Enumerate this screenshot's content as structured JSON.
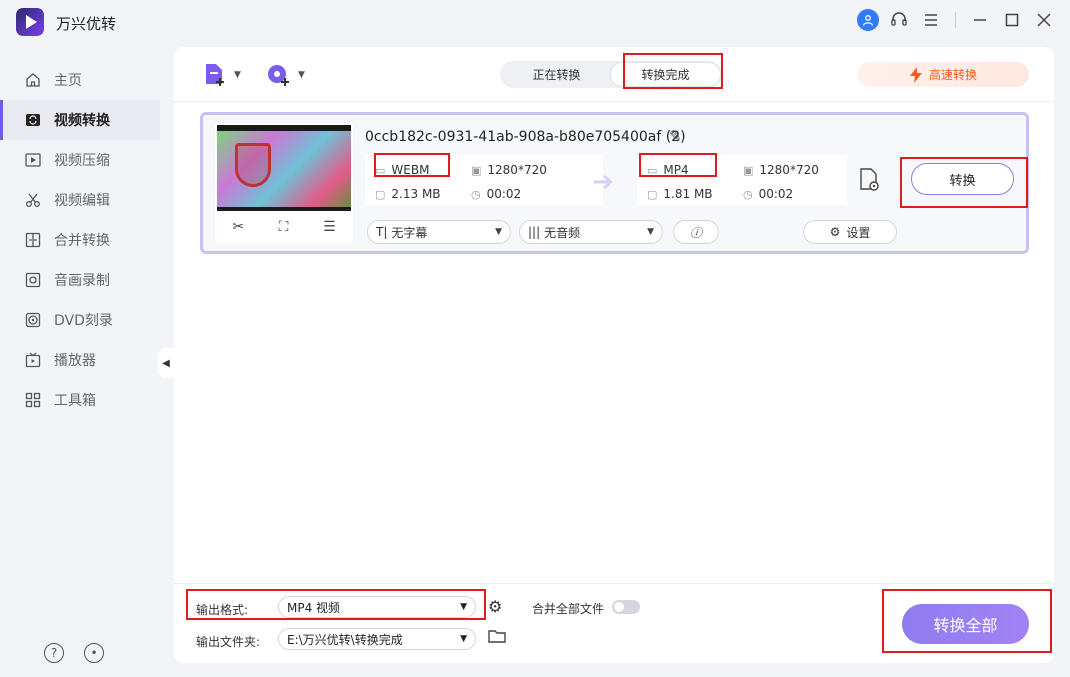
{
  "app": {
    "title": "万兴优转"
  },
  "window_controls": {
    "user": "user-icon",
    "support": "headset-icon",
    "menu": "menu-icon",
    "minimize": "—",
    "maximize": "☐",
    "close": "✕"
  },
  "sidebar": {
    "items": [
      {
        "label": "主页",
        "icon": "home-icon"
      },
      {
        "label": "视频转换",
        "icon": "convert-icon",
        "active": true
      },
      {
        "label": "视频压缩",
        "icon": "compress-icon"
      },
      {
        "label": "视频编辑",
        "icon": "scissors-icon"
      },
      {
        "label": "合并转换",
        "icon": "merge-icon"
      },
      {
        "label": "音画录制",
        "icon": "record-icon"
      },
      {
        "label": "DVD刻录",
        "icon": "disc-icon"
      },
      {
        "label": "播放器",
        "icon": "tv-icon"
      },
      {
        "label": "工具箱",
        "icon": "grid-icon"
      }
    ]
  },
  "toolbar": {
    "tabs": [
      {
        "label": "正在转换"
      },
      {
        "label": "转换完成",
        "active": true
      }
    ],
    "fast_convert": "高速转换"
  },
  "file": {
    "name": "0ccb182c-0931-41ab-908a-b80e705400af (2)",
    "source": {
      "format": "WEBM",
      "resolution": "1280*720",
      "size": "2.13 MB",
      "duration": "00:02"
    },
    "target": {
      "format": "MP4",
      "resolution": "1280*720",
      "size": "1.81 MB",
      "duration": "00:02"
    },
    "subtitle": "无字幕",
    "audio": "无音频",
    "settings": "设置",
    "convert": "转换"
  },
  "bottom": {
    "output_format_label": "输出格式:",
    "output_format_value": "MP4 视频",
    "merge_label": "合并全部文件",
    "output_folder_label": "输出文件夹:",
    "output_folder_value": "E:\\万兴优转\\转换完成",
    "convert_all": "转换全部"
  },
  "colors": {
    "accent": "#8f7bf0",
    "highlight": "#e01b1b",
    "fast": "#ff5a1f"
  }
}
